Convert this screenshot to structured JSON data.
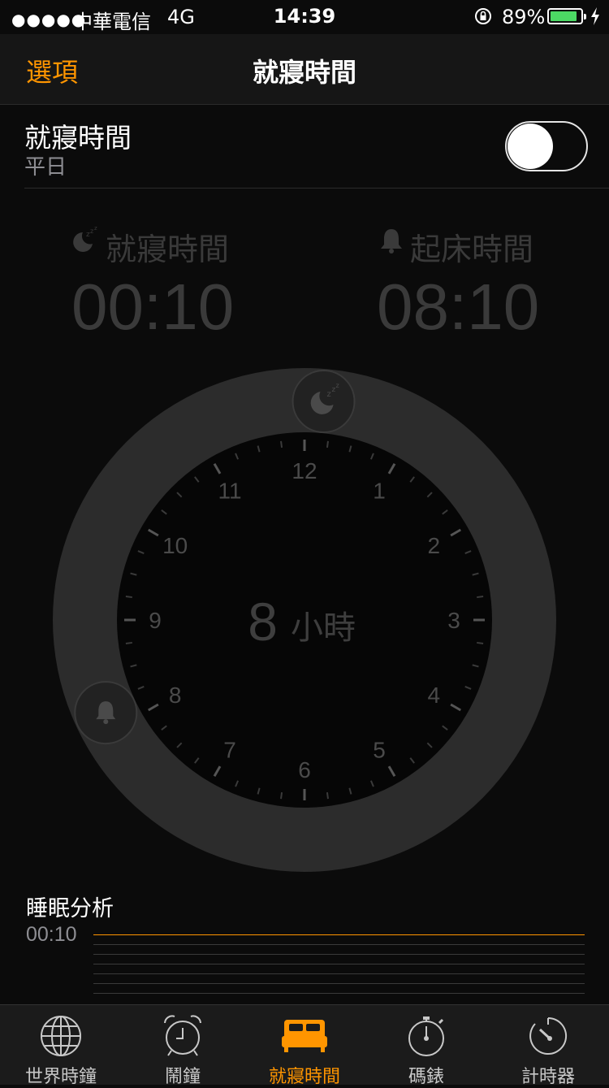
{
  "status_bar": {
    "signal": "●●●●●",
    "carrier": "中華電信",
    "network": "4G",
    "time": "14:39",
    "battery_percent": "89%",
    "battery_level": 0.89,
    "battery_color": "#4cd964"
  },
  "nav": {
    "options_label": "選項",
    "title": "就寢時間"
  },
  "bedtime_row": {
    "title": "就寢時間",
    "subtitle": "平日",
    "toggle_on": false
  },
  "times": {
    "bedtime_label": "就寢時間",
    "bedtime_value": "00:10",
    "bedtime_icon": "moon-zzz-icon",
    "wake_label": "起床時間",
    "wake_value": "08:10",
    "wake_icon": "bell-icon"
  },
  "clock": {
    "numbers": [
      "12",
      "1",
      "2",
      "3",
      "4",
      "5",
      "6",
      "7",
      "8",
      "9",
      "10",
      "11"
    ],
    "duration_value": "8",
    "duration_unit": "小時",
    "bedtime_hour": 0.1667,
    "wake_hour": 8.1667
  },
  "analysis": {
    "title": "睡眠分析",
    "time_label": "00:10"
  },
  "tabs": [
    {
      "label": "世界時鐘",
      "icon": "globe-icon",
      "active": false
    },
    {
      "label": "鬧鐘",
      "icon": "alarm-clock-icon",
      "active": false
    },
    {
      "label": "就寢時間",
      "icon": "bed-icon",
      "active": true
    },
    {
      "label": "碼錶",
      "icon": "stopwatch-icon",
      "active": false
    },
    {
      "label": "計時器",
      "icon": "timer-icon",
      "active": false
    }
  ],
  "colors": {
    "accent": "#ff9500",
    "background": "#0b0b0b"
  }
}
